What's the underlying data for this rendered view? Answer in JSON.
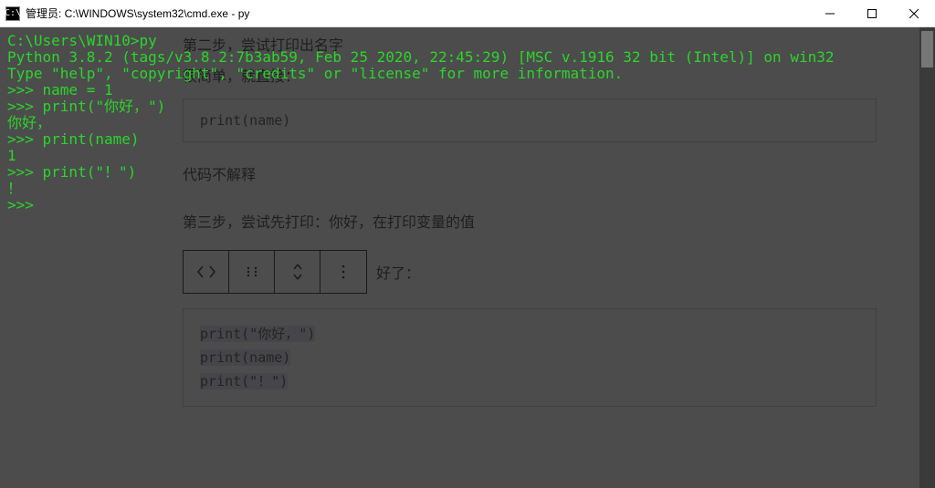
{
  "window": {
    "icon_text": "C:\\",
    "title": "管理员: C:\\WINDOWS\\system32\\cmd.exe - py"
  },
  "background": {
    "step2": "第二步，尝试打印出名字",
    "simple": "很简单，就直接：",
    "code1": "print(name)",
    "noexplain": "代码不解释",
    "step3": "第三步，尝试先打印：你好，在打印变量的值",
    "after_toolbar": "好了：",
    "code2_line1": "print(\"你好，\")",
    "code2_line2": "print(name)",
    "code2_line3": "print(\"！\")"
  },
  "terminal": {
    "lines": [
      "C:\\Users\\WIN10>py",
      "Python 3.8.2 (tags/v3.8.2:7b3ab59, Feb 25 2020, 22:45:29) [MSC v.1916 32 bit (Intel)] on win32",
      "Type \"help\", \"copyright\", \"credits\" or \"license\" for more information.",
      ">>> name = 1",
      ">>> print(\"你好，\")",
      "你好，",
      ">>> print(name)",
      "1",
      ">>> print(\"！\")",
      "！",
      ">>> "
    ]
  }
}
